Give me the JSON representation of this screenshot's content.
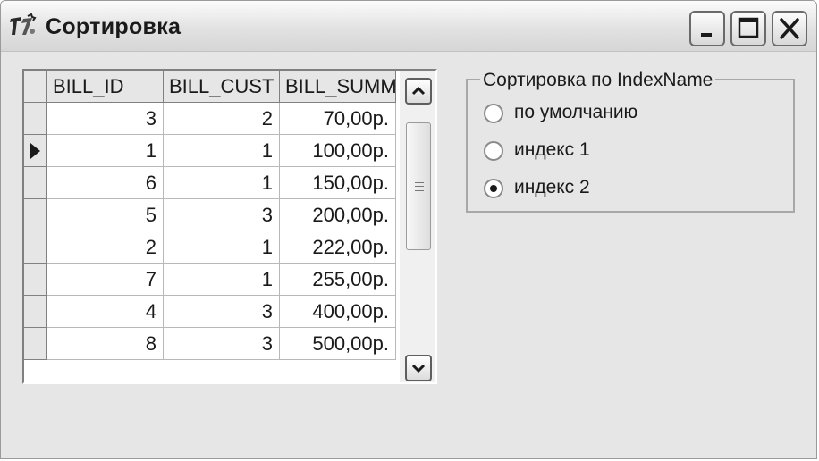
{
  "window": {
    "title": "Сортировка"
  },
  "grid": {
    "columns": [
      "BILL_ID",
      "BILL_CUST",
      "BILL_SUMM"
    ],
    "current_row": 1,
    "rows": [
      [
        "3",
        "2",
        "70,00р."
      ],
      [
        "1",
        "1",
        "100,00р."
      ],
      [
        "6",
        "1",
        "150,00р."
      ],
      [
        "5",
        "3",
        "200,00р."
      ],
      [
        "2",
        "1",
        "222,00р."
      ],
      [
        "7",
        "1",
        "255,00р."
      ],
      [
        "4",
        "3",
        "400,00р."
      ],
      [
        "8",
        "3",
        "500,00р."
      ]
    ]
  },
  "sort_group": {
    "caption": "Сортировка по IndexName",
    "selected": 2,
    "options": [
      "по умолчанию",
      "индекс 1",
      "индекс 2"
    ]
  },
  "icons": {
    "app": "delphi-app-icon",
    "minimize": "minimize-icon",
    "maximize": "maximize-icon",
    "close": "close-icon",
    "row_pointer": "row-pointer-icon",
    "scroll_up": "scroll-up-icon",
    "scroll_down": "scroll-down-icon"
  }
}
